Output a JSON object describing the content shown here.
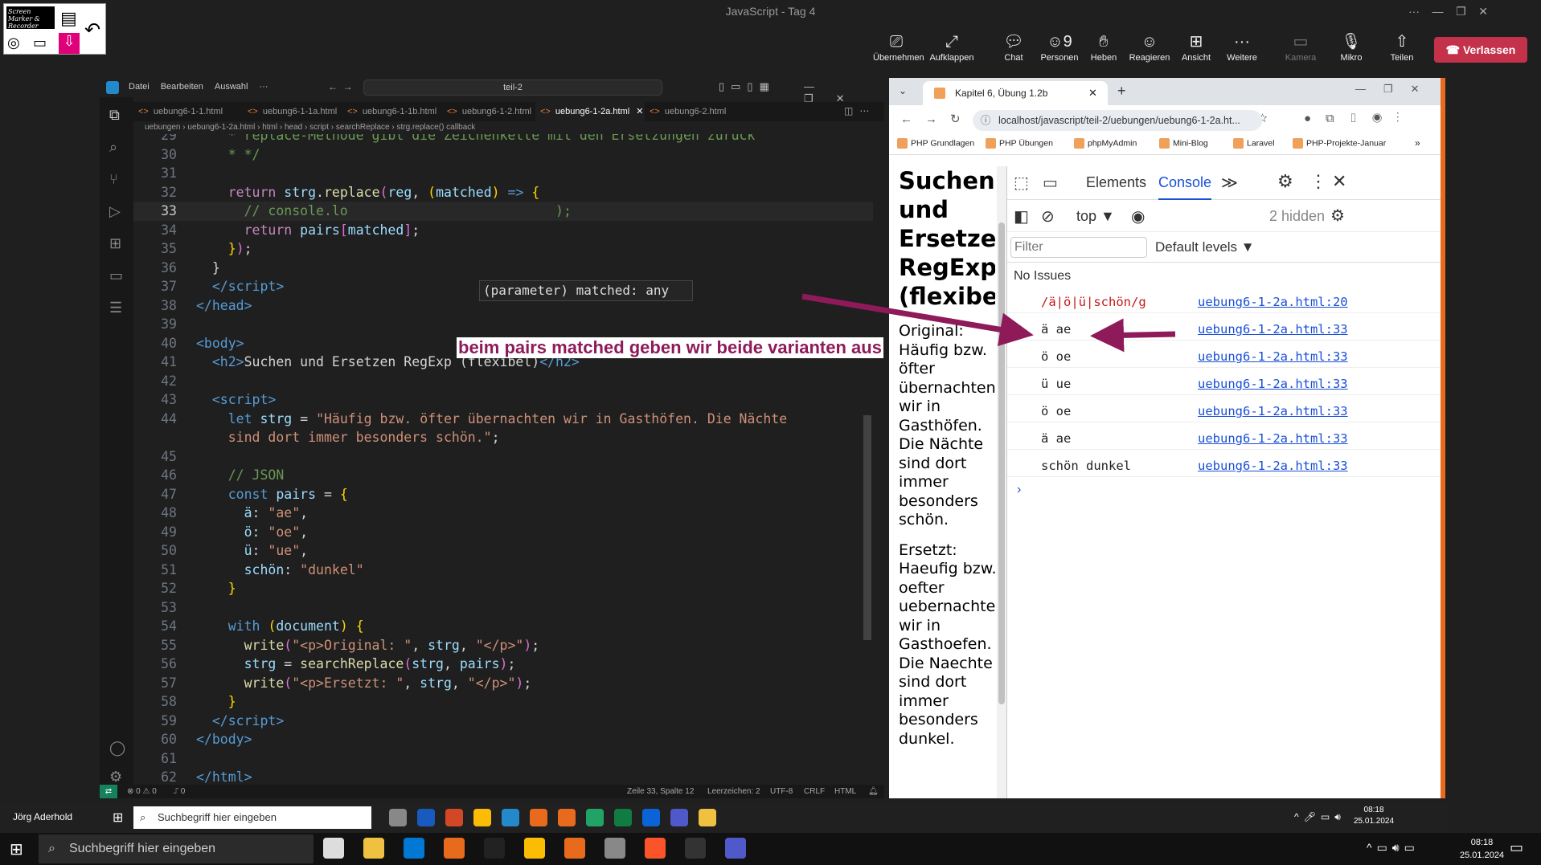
{
  "teams": {
    "window_title": "JavaScript - Tag 4",
    "buttons": [
      {
        "label": "Übernehmen",
        "icon": "share-icon"
      },
      {
        "label": "Aufklappen",
        "icon": "expand-icon"
      },
      {
        "label": "Chat",
        "icon": "chat-icon"
      },
      {
        "label": "Personen",
        "icon": "people-icon",
        "count": "9"
      },
      {
        "label": "Heben",
        "icon": "hand-icon"
      },
      {
        "label": "Reagieren",
        "icon": "emoji-icon"
      },
      {
        "label": "Ansicht",
        "icon": "view-icon"
      },
      {
        "label": "Weitere",
        "icon": "more-icon"
      },
      {
        "label": "Kamera",
        "icon": "camera-off-icon"
      },
      {
        "label": "Mikro",
        "icon": "mic-off-icon"
      },
      {
        "label": "Teilen",
        "icon": "share-tray-icon"
      }
    ],
    "leave": "Verlassen"
  },
  "screenmarker": {
    "label": "Screen Marker & Recorder"
  },
  "vscode": {
    "menu": [
      "Datei",
      "Bearbeiten",
      "Auswahl",
      "···"
    ],
    "search": "teil-2",
    "tabs": [
      "uebung6-1-1.html",
      "uebung6-1-1a.html",
      "uebung6-1-1b.html",
      "uebung6-1-2.html",
      "uebung6-1-2a.html",
      "uebung6-2.html"
    ],
    "active_tab": "uebung6-1-2a.html",
    "breadcrumb": "uebungen  ›  uebung6-1-2a.html  ›  html  ›  head  ›  script  ›  searchReplace  ›  strg.replace() callback",
    "hover": "(parameter) matched: any",
    "annotation": "beim pairs matched geben wir beide varianten aus",
    "status": {
      "errors": "⊗ 0 ⚠ 0",
      "ports": "⑀ 0",
      "position": "Zeile 33, Spalte 12",
      "indent": "Leerzeichen: 2",
      "encoding": "UTF-8",
      "eol": "CRLF",
      "lang": "HTML"
    }
  },
  "chrome": {
    "tab_title": "Kapitel 6, Übung 1.2b",
    "url": "localhost/javascript/teil-2/uebungen/uebung6-1-2a.ht...",
    "bookmarks": [
      "PHP Grundlagen",
      "PHP Übungen",
      "phpMyAdmin",
      "Mini-Blog",
      "Laravel",
      "PHP-Projekte-Januar"
    ],
    "page": {
      "heading": "Suchen und Ersetzen RegExp (flexibel)",
      "original": "Original: Häufig bzw. öfter übernachten wir in Gasthöfen. Die Nächte sind dort immer besonders schön.",
      "replaced": "Ersetzt: Haeufig bzw. oefter uebernachten wir in Gasthoefen. Die Naechte sind dort immer besonders dunkel."
    },
    "devtools": {
      "tabs": [
        "Elements",
        "Console"
      ],
      "active": "Console",
      "context": "top",
      "hidden": "2 hidden",
      "filter_placeholder": "Filter",
      "levels": "Default levels",
      "issues": "No Issues",
      "console": [
        {
          "msg": "/ä|ö|ü|schön/g",
          "src": "uebung6-1-2a.html:20",
          "color": "#c41a16"
        },
        {
          "msg": "ä ae",
          "src": "uebung6-1-2a.html:33"
        },
        {
          "msg": "ö oe",
          "src": "uebung6-1-2a.html:33"
        },
        {
          "msg": "ü ue",
          "src": "uebung6-1-2a.html:33"
        },
        {
          "msg": "ö oe",
          "src": "uebung6-1-2a.html:33"
        },
        {
          "msg": "ä ae",
          "src": "uebung6-1-2a.html:33"
        },
        {
          "msg": "schön dunkel",
          "src": "uebung6-1-2a.html:33"
        }
      ]
    }
  },
  "taskbar_inner": {
    "user": "Jörg Aderhold",
    "search": "Suchbegriff hier eingeben",
    "time": "08:18",
    "date": "25.01.2024"
  },
  "taskbar_outer": {
    "search": "Suchbegriff hier eingeben",
    "time": "08:18",
    "date": "25.01.2024"
  }
}
